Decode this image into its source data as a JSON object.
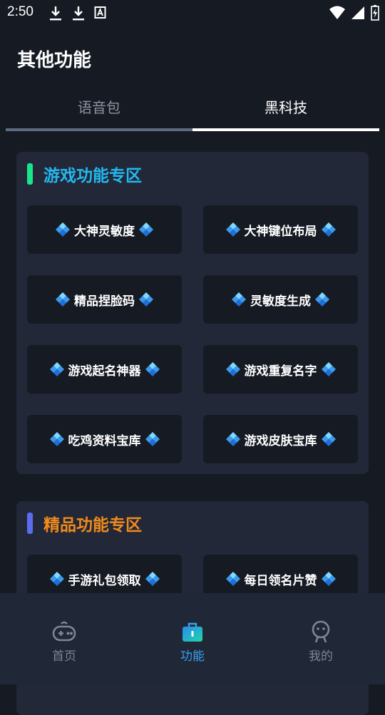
{
  "status_bar": {
    "time": "2:50",
    "left_icons": [
      "download-icon",
      "download-icon",
      "a-badge-icon"
    ],
    "right_icons": [
      "wifi-icon",
      "signal-icon",
      "battery-icon"
    ]
  },
  "page_title": "其他功能",
  "tabs": [
    {
      "label": "语音包",
      "active": false
    },
    {
      "label": "黑科技",
      "active": true
    }
  ],
  "sections": [
    {
      "title": "游戏功能专区",
      "accent_color": "#19e68c",
      "title_color": "#23b8f0",
      "buttons": [
        "大神灵敏度",
        "大神键位布局",
        "精品捏脸码",
        "灵敏度生成",
        "游戏起名神器",
        "游戏重复名字",
        "吃鸡资料宝库",
        "游戏皮肤宝库"
      ]
    },
    {
      "title": "精品功能专区",
      "accent_color": "#5b6cf0",
      "title_color": "#f08a1c",
      "buttons": [
        "手游礼包领取",
        "每日领名片赞"
      ]
    }
  ],
  "bottom_nav": [
    {
      "label": "首页",
      "icon": "gamepad-icon",
      "active": false
    },
    {
      "label": "功能",
      "icon": "briefcase-icon",
      "active": true
    },
    {
      "label": "我的",
      "icon": "person-icon",
      "active": false
    }
  ],
  "colors": {
    "background": "#161a23",
    "card": "#222838",
    "nav_active": "#3aa0ee",
    "nav_inactive": "#7d8696"
  }
}
